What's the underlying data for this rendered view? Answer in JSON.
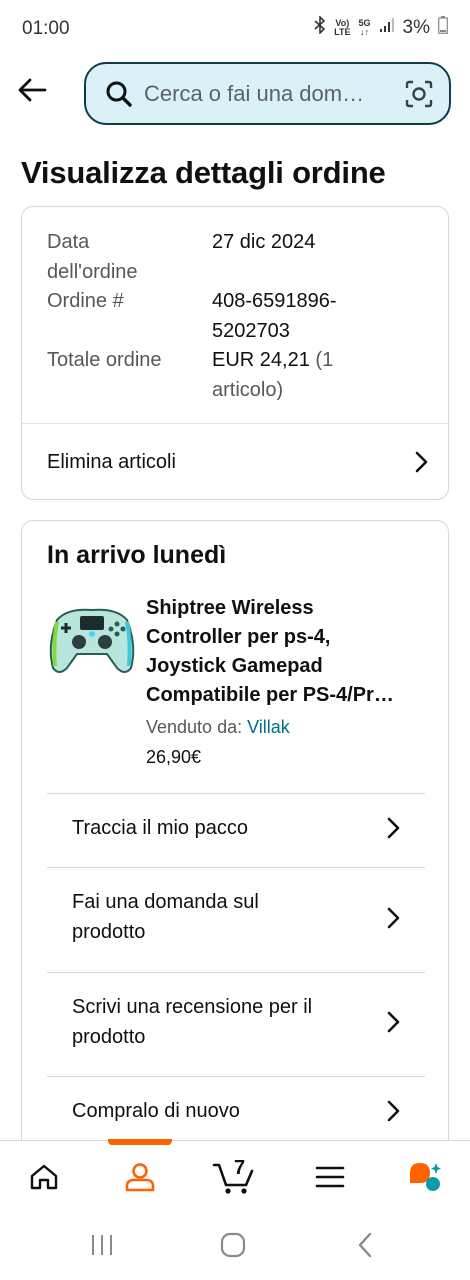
{
  "status_bar": {
    "time": "01:00",
    "network_top": "Vo)",
    "network_bottom": "LTE",
    "gen_top": "5G",
    "gen_bottom": "↓↑",
    "battery": "3%"
  },
  "search": {
    "placeholder": "Cerca o fai una dom…"
  },
  "page": {
    "title": "Visualizza dettagli ordine"
  },
  "summary": {
    "date_label_1": "Data",
    "date_label_2": "dell'ordine",
    "date_value": "27 dic 2024",
    "order_label": "Ordine #",
    "order_value_1": "408-6591896-",
    "order_value_2": "5202703",
    "total_label": "Totale ordine",
    "total_value": "EUR 24,21",
    "total_items_1": "(1",
    "total_items_2": "articolo)",
    "delete_label": "Elimina articoli"
  },
  "shipment": {
    "title": "In arrivo lunedì",
    "product_lines": [
      "Shiptree Wireless",
      "Controller per ps-4,",
      "Joystick Gamepad",
      "Compatibile per PS-4/Pr…"
    ],
    "seller_label": "Venduto da:",
    "seller_name": "Villak",
    "price": "26,90€",
    "actions": {
      "track": "Traccia il mio pacco",
      "ask_1": "Fai una domanda sul",
      "ask_2": "prodotto",
      "review_1": "Scrivi una recensione per il",
      "review_2": "prodotto",
      "buy_again": "Compralo di nuovo"
    }
  },
  "bottom_nav": {
    "cart_count": "7",
    "items": [
      "home-icon",
      "account-icon",
      "cart-icon",
      "menu-icon",
      "rufus-icon"
    ],
    "active": "account-icon",
    "accent": "#ff6200"
  },
  "colors": {
    "search_bg": "#d9f1f7",
    "link": "#007185",
    "text": "#0f1111",
    "muted": "#565959"
  }
}
